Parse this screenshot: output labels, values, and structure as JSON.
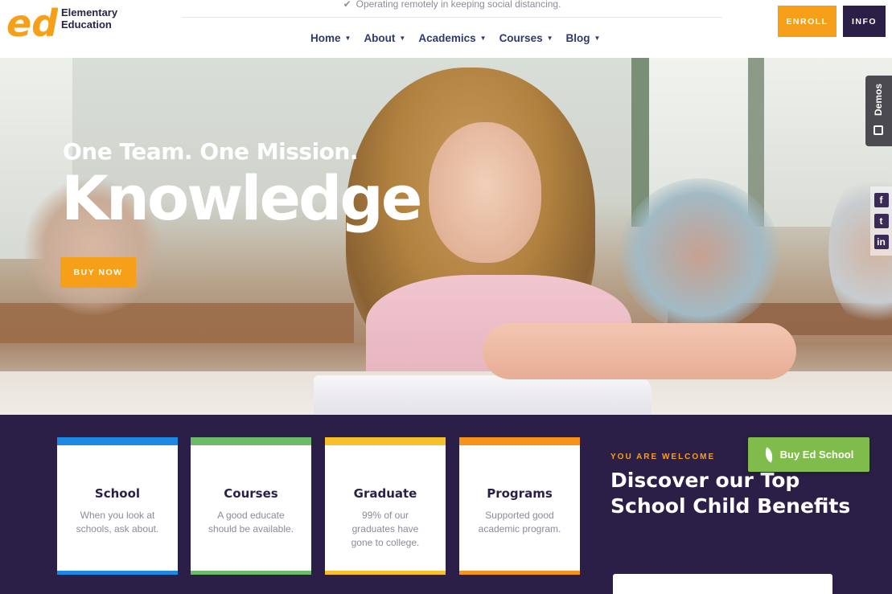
{
  "brand": {
    "logo_letters": "ed",
    "name_line1": "Elementary",
    "name_line2": "Education",
    "primary_color": "#f6a01a",
    "dark_color": "#2b1f47"
  },
  "notice": {
    "icon": "check-icon",
    "text": "Operating remotely in keeping social distancing."
  },
  "nav": {
    "items": [
      {
        "label": "Home"
      },
      {
        "label": "About"
      },
      {
        "label": "Academics"
      },
      {
        "label": "Courses"
      },
      {
        "label": "Blog"
      }
    ]
  },
  "header_buttons": {
    "enroll": "ENROLL",
    "info": "INFO"
  },
  "hero": {
    "subtitle": "One Team. One Mission.",
    "title": "Knowledge",
    "cta": "BUY NOW"
  },
  "side": {
    "demos_label": "Demos",
    "social": [
      {
        "icon": "facebook-icon",
        "glyph": "f"
      },
      {
        "icon": "twitter-icon",
        "glyph": "t"
      },
      {
        "icon": "linkedin-icon",
        "glyph": "in"
      }
    ]
  },
  "features": {
    "cards": [
      {
        "title": "School",
        "desc": "When you look at schools, ask about.",
        "color": "#1e88e5"
      },
      {
        "title": "Courses",
        "desc": "A good educate should be available.",
        "color": "#6dbb6a"
      },
      {
        "title": "Graduate",
        "desc": "99% of our graduates have gone to college.",
        "color": "#f7c02b"
      },
      {
        "title": "Programs",
        "desc": "Supported good academic program.",
        "color": "#f6941a"
      }
    ],
    "welcome": "YOU ARE WELCOME",
    "heading": "Discover our Top School Child Benefits",
    "buy_button": "Buy Ed School"
  }
}
